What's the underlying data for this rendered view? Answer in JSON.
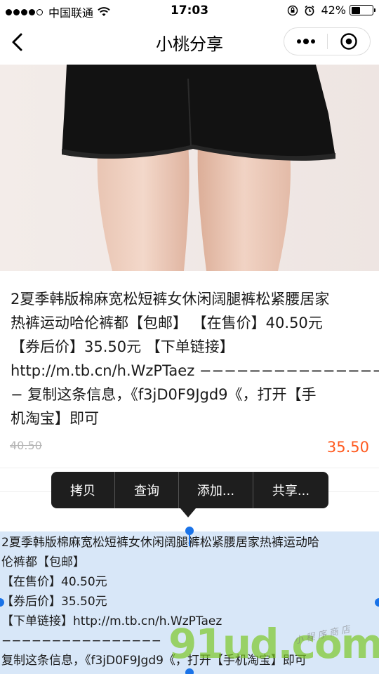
{
  "status_bar": {
    "carrier": "中国联通",
    "time": "17:03",
    "battery": "42%",
    "battery_level": 0.42,
    "icons": [
      "signal-dots",
      "wifi-icon",
      "orientation-lock-icon",
      "alarm-icon",
      "battery-icon"
    ]
  },
  "nav": {
    "title": "小桃分享",
    "back_icon": "chevron-left-icon",
    "more_icon": "more-dots-icon",
    "close_icon": "target-close-icon"
  },
  "product": {
    "description_lines": [
      "2夏季韩版棉麻宽松短裤女休闲阔腿裤松紧腰居家",
      "热裤运动哈伦裤都【包邮】 【在售价】40.50元",
      "【券后价】35.50元 【下单链接】",
      "http://m.tb.cn/h.WzPTaez −−−−−−−−−−−−−−−−",
      "− 复制这条信息，《f3jD0F9Jgd9《，打开【手",
      "机淘宝】即可"
    ],
    "original_price": "40.50",
    "coupon_price": "35.50"
  },
  "context_menu": {
    "items": [
      "拷贝",
      "查询",
      "添加...",
      "共享..."
    ]
  },
  "selected_text": {
    "lines": [
      "2夏季韩版棉麻宽松短裤女休闲阔腿裤松紧腰居家热裤运动哈",
      "伦裤都【包邮】",
      "【在售价】40.50元",
      "【券后价】35.50元",
      "【下单链接】http://m.tb.cn/h.WzPTaez",
      "−−−−−−−−−−−−−−−−",
      "复制这条信息，《f3jD0F9Jgd9《，打开【手机淘宝】即可"
    ]
  },
  "watermark": {
    "logo": "91ud.com",
    "text": "小程序商店"
  },
  "colors": {
    "accent": "#ff5a1f",
    "selection": "#d8e7f8",
    "handle": "#1a73e8",
    "menu_bg": "#1e1e1e"
  }
}
